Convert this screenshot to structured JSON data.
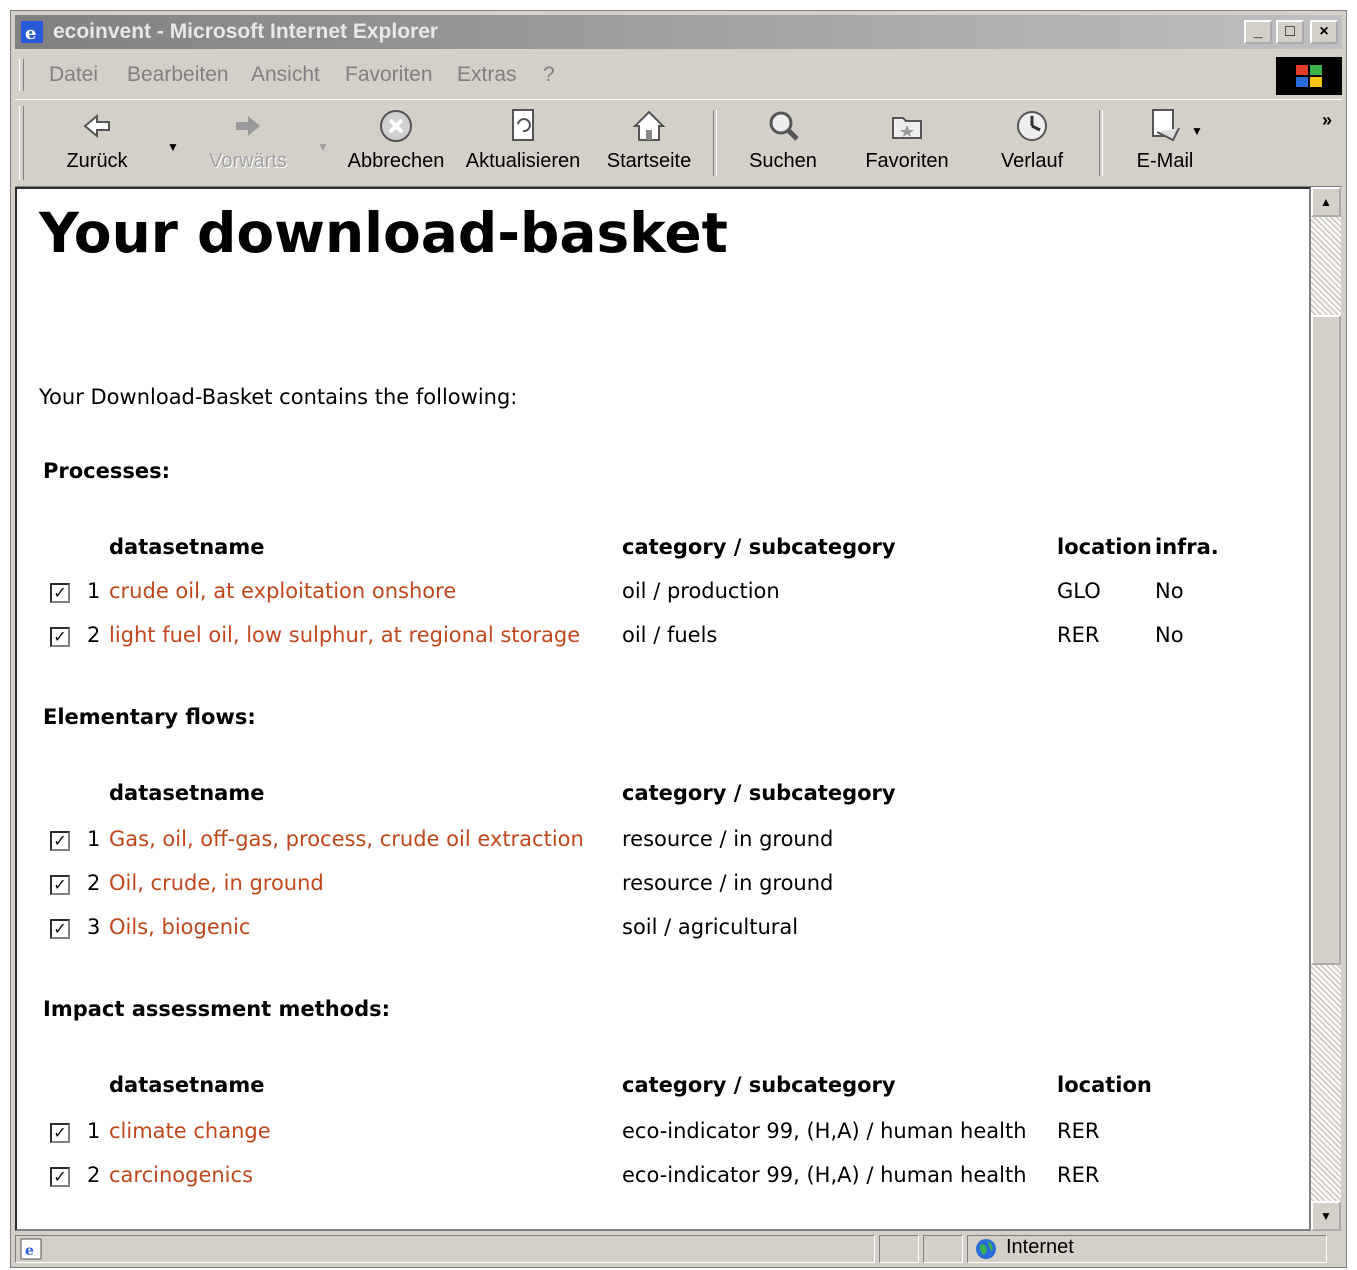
{
  "window": {
    "title": "ecoinvent - Microsoft Internet Explorer",
    "controls": [
      "_",
      "□",
      "×"
    ]
  },
  "menu": [
    "Datei",
    "Bearbeiten",
    "Ansicht",
    "Favoriten",
    "Extras",
    "?"
  ],
  "toolbar": {
    "back": "Zurück",
    "forward": "Vorwärts",
    "stop": "Abbrechen",
    "refresh": "Aktualisieren",
    "home": "Startseite",
    "search": "Suchen",
    "favorites": "Favoriten",
    "history": "Verlauf",
    "mail": "E-Mail",
    "more": "»"
  },
  "page": {
    "heading": "Your download-basket",
    "intro": "Your Download-Basket contains the following:",
    "columns": {
      "name": "datasetname",
      "category": "category / subcategory",
      "location": "location",
      "infra": "infra."
    },
    "processes": {
      "title": "Processes:",
      "rows": [
        {
          "num": "1",
          "name": "crude oil, at exploitation onshore",
          "category": "oil / production",
          "location": "GLO",
          "infra": "No",
          "checked": true
        },
        {
          "num": "2",
          "name": "light fuel oil, low sulphur, at regional storage",
          "category": "oil / fuels",
          "location": "RER",
          "infra": "No",
          "checked": true
        }
      ]
    },
    "flows": {
      "title": "Elementary flows:",
      "rows": [
        {
          "num": "1",
          "name": "Gas, oil, off-gas, process, crude oil extraction",
          "category": "resource / in ground",
          "checked": true
        },
        {
          "num": "2",
          "name": "Oil, crude, in ground",
          "category": "resource / in ground",
          "checked": true
        },
        {
          "num": "3",
          "name": "Oils, biogenic",
          "category": "soil / agricultural",
          "checked": true
        }
      ]
    },
    "methods": {
      "title": "Impact assessment methods:",
      "rows": [
        {
          "num": "1",
          "name": "climate change",
          "category": "eco-indicator 99, (H,A) / human health",
          "location": "RER",
          "checked": true
        },
        {
          "num": "2",
          "name": "carcinogenics",
          "category": "eco-indicator 99, (H,A) / human health",
          "location": "RER",
          "checked": true
        }
      ]
    }
  },
  "status": {
    "zone": "Internet"
  },
  "colors": {
    "link": "#c0471c",
    "chrome": "#d4d0c8"
  }
}
